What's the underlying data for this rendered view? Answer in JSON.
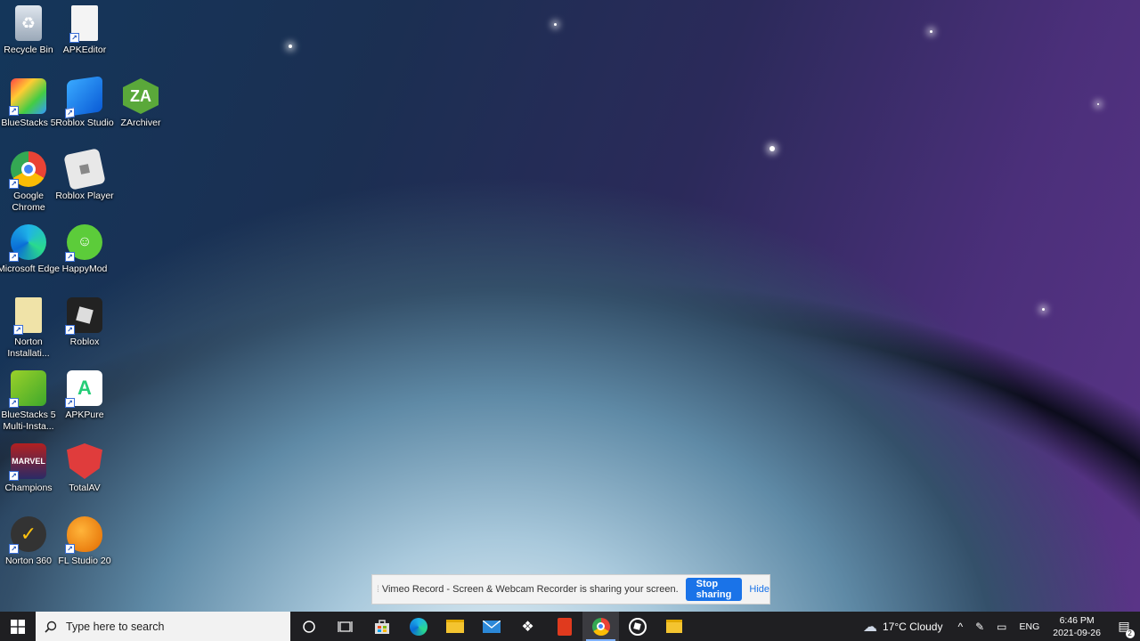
{
  "desktop": {
    "icons": [
      {
        "name": "Recycle Bin"
      },
      {
        "name": "APKEditor"
      },
      {
        "name": "BlueStacks 5"
      },
      {
        "name": "Roblox Studio"
      },
      {
        "name": "ZArchiver"
      },
      {
        "name": "Google Chrome"
      },
      {
        "name": "Roblox Player"
      },
      {
        "name": "Microsoft Edge"
      },
      {
        "name": "HappyMod"
      },
      {
        "name": "Norton Installati..."
      },
      {
        "name": "Roblox"
      },
      {
        "name": "BlueStacks 5 Multi-Insta..."
      },
      {
        "name": "APKPure"
      },
      {
        "name": "Champions"
      },
      {
        "name": "TotalAV"
      },
      {
        "name": "Norton 360"
      },
      {
        "name": "FL Studio 20"
      }
    ]
  },
  "share_bar": {
    "message": "Vimeo Record - Screen & Webcam Recorder is sharing your screen.",
    "stop_label": "Stop sharing",
    "hide_label": "Hide"
  },
  "taskbar": {
    "search_placeholder": "Type here to search",
    "pinned": [
      "cortana-icon",
      "task-view-icon",
      "store-icon",
      "edge-icon",
      "file-explorer-icon",
      "mail-icon",
      "dropbox-icon",
      "office-icon",
      "chrome-icon",
      "roblox-icon",
      "folder-icon"
    ],
    "weather": "17°C  Cloudy",
    "language": "ENG",
    "time": "6:46 PM",
    "date": "2021-09-26",
    "notification_count": "2"
  },
  "colors": {
    "taskbar": "#1f1f22",
    "accent": "#1a73e8"
  }
}
